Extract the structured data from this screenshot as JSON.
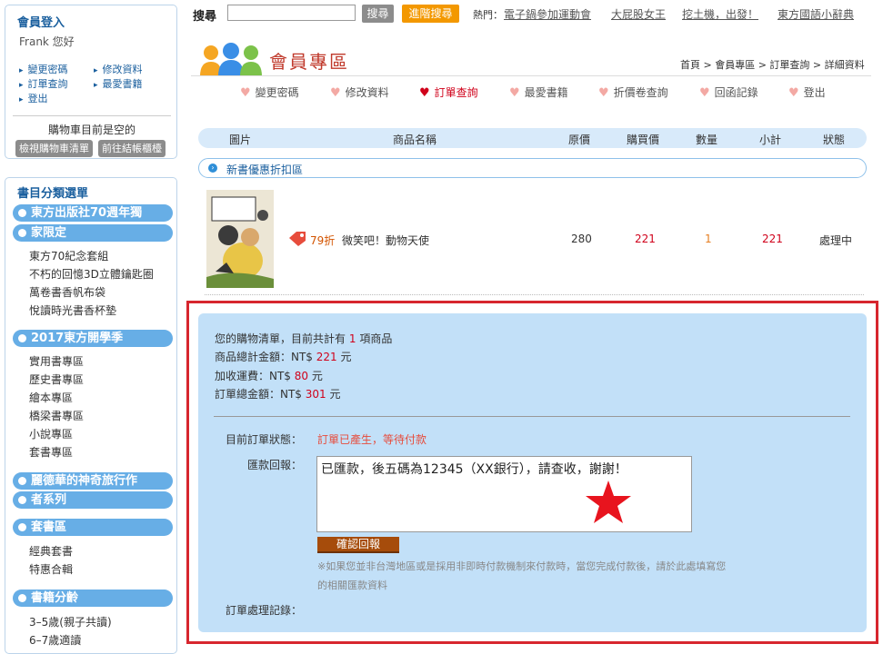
{
  "login": {
    "title": "會員登入",
    "user": "Frank 您好",
    "links": [
      "變更密碼",
      "修改資料",
      "訂單查詢",
      "最愛書籍",
      "登出"
    ],
    "cart_empty": "購物車目前是空的",
    "view_cart": "檢視購物車清單",
    "checkout": "前往結帳櫃檯"
  },
  "menu": {
    "title": "書目分類選單",
    "groups": [
      {
        "label_lines": [
          "東方出版社70週年獨",
          "家限定"
        ],
        "items": [
          "東方70紀念套組",
          "不朽的回憶3D立體鑰匙圈",
          "萬卷書香帆布袋",
          "悅讀時光書香杯墊"
        ]
      },
      {
        "label_lines": [
          "2017東方開學季"
        ],
        "items": [
          "實用書專區",
          "歷史書專區",
          "繪本專區",
          "橋梁書專區",
          "小說專區",
          "套書專區"
        ]
      },
      {
        "label_lines": [
          "麗德華的神奇旅行作",
          "者系列"
        ],
        "items": []
      },
      {
        "label_lines": [
          "套書區"
        ],
        "items": [
          "經典套書",
          "特惠合輯"
        ]
      },
      {
        "label_lines": [
          "書籍分齡"
        ],
        "items": [
          "3–5歲(親子共讀)",
          "6–7歲適讀"
        ]
      }
    ]
  },
  "search": {
    "label": "搜尋",
    "value": "",
    "button": "搜尋",
    "advanced": "進階搜尋",
    "hot_label": "熱門：",
    "hot_links": [
      "電子鍋參加運動會",
      "大屁股女王",
      "挖土機，出發！",
      "東方國語小辭典"
    ]
  },
  "zone": {
    "title": "會員專區",
    "breadcrumb": "首頁 > 會員專區 > 訂單查詢 > 詳細資料",
    "tabs": [
      "變更密碼",
      "修改資料",
      "訂單查詢",
      "最愛書籍",
      "折價卷查詢",
      "回函記錄",
      "登出"
    ],
    "active_tab": 2
  },
  "table": {
    "headers": [
      "圖片",
      "商品名稱",
      "原價",
      "購買價",
      "數量",
      "小計",
      "狀態"
    ],
    "promo": "新書優惠折扣區",
    "rows": [
      {
        "discount": "79折",
        "name": "微笑吧！動物天使",
        "price": "280",
        "sale": "221",
        "qty": "1",
        "subtotal": "221",
        "status": "處理中",
        "cover_title": "微笑吧！動物天使"
      }
    ]
  },
  "summary": {
    "count_pre": "您的購物清單，目前共計有",
    "count": "1",
    "count_post": "項商品",
    "total_label": "商品總計金額：NT$",
    "total": "221",
    "shipping_label": "加收運費：NT$",
    "shipping": "80",
    "grand_label": "訂單總金額：NT$",
    "grand": "301",
    "unit": "元",
    "status_label": "目前訂單狀態：",
    "status": "訂單已產生，等待付款",
    "remit_label": "匯款回報：",
    "remit_text": "已匯款，後五碼為12345（XX銀行），請查收，謝謝！",
    "confirm": "確認回報",
    "note_line1": "※如果您並非台灣地區或是採用非即時付款機制來付款時，當您完成付款後，請於此處填寫您",
    "note_line2": "的相關匯款資料",
    "log_label": "訂單處理記錄："
  },
  "colors": {
    "accent": "#d0021b",
    "panel": "#c2e0f8",
    "menu": "#67aee6",
    "orange": "#f39800"
  }
}
